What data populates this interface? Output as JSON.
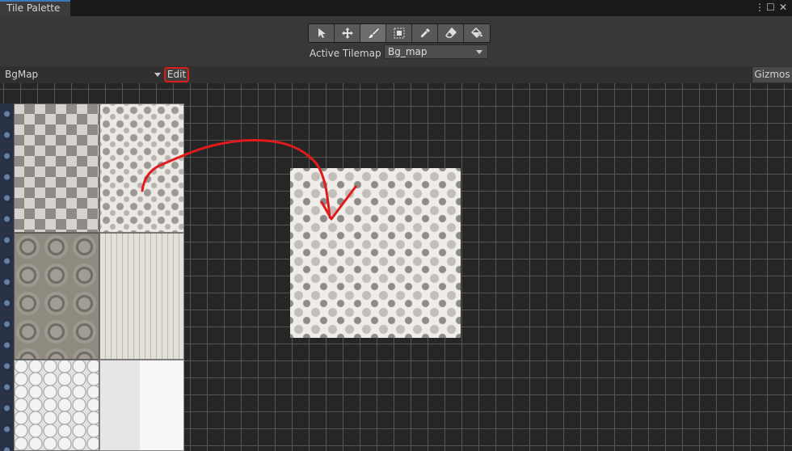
{
  "window": {
    "tab_title": "Tile Palette"
  },
  "window_controls": {
    "menu": "⋮",
    "maximize": "☐",
    "close": "✕"
  },
  "toolbar": {
    "tools": [
      {
        "name": "select",
        "icon": "cursor-icon",
        "active": false
      },
      {
        "name": "move",
        "icon": "move-icon",
        "active": false
      },
      {
        "name": "paint",
        "icon": "brush-icon",
        "active": true
      },
      {
        "name": "box-fill",
        "icon": "box-fill-icon",
        "active": false
      },
      {
        "name": "picker",
        "icon": "eyedropper-icon",
        "active": false
      },
      {
        "name": "erase",
        "icon": "eraser-icon",
        "active": false
      },
      {
        "name": "fill",
        "icon": "paint-bucket-icon",
        "active": false
      }
    ],
    "active_tilemap_label": "Active Tilemap",
    "active_tilemap_value": "Bg_map"
  },
  "palette_bar": {
    "palette_name": "BgMap",
    "edit_label": "Edit",
    "gizmos_label": "Gizmos"
  },
  "colors": {
    "accent_tab": "#3a79bb",
    "highlight_annotation": "#e11b1b",
    "panel_bg": "#383838",
    "canvas_bg": "#262626"
  }
}
